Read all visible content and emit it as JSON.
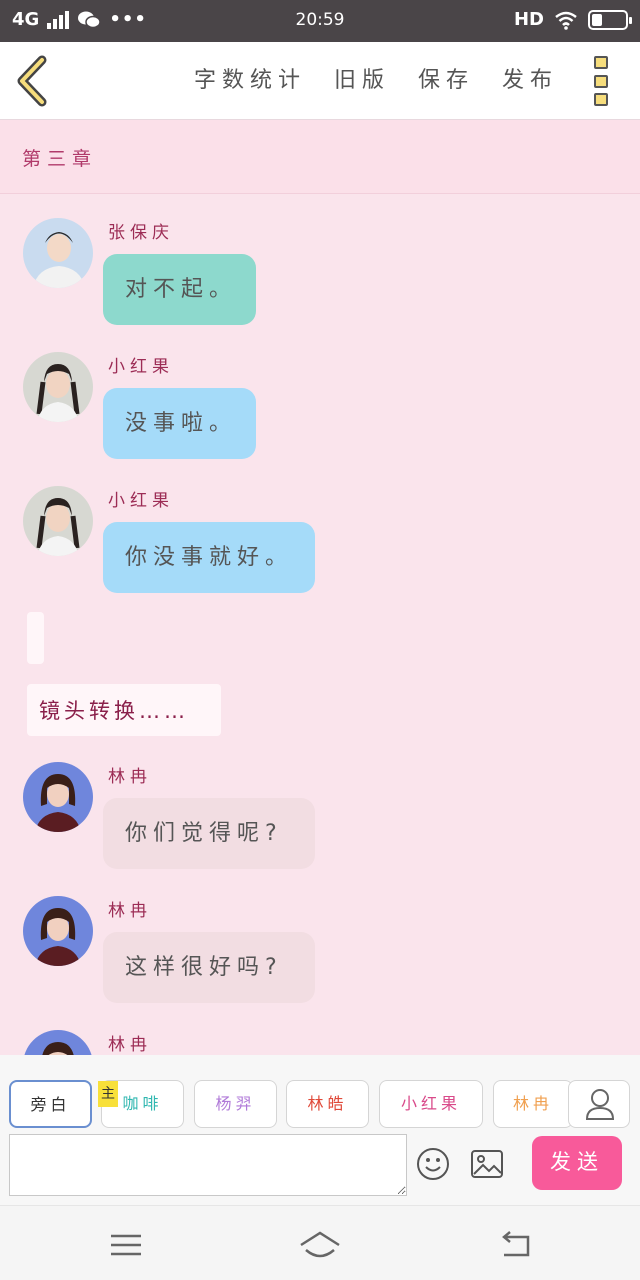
{
  "status_bar": {
    "network": "4G",
    "time": "20:59",
    "hd": "HD"
  },
  "toolbar": {
    "actions": [
      "字数统计",
      "旧版",
      "保存",
      "发布"
    ]
  },
  "chapter": {
    "title": "第三章"
  },
  "messages": [
    {
      "name": "张保庆",
      "text": "对不起。",
      "bubble_color": "#8dd9cd",
      "avatar": "male-portrait"
    },
    {
      "name": "小红果",
      "text": "没事啦。",
      "bubble_color": "#a5dbf9",
      "avatar": "braids-portrait"
    },
    {
      "name": "小红果",
      "text": "你没事就好。",
      "bubble_color": "#a5dbf9",
      "avatar": "braids-portrait"
    },
    {
      "name": "林冉",
      "text": "你们觉得呢?",
      "bubble_color": "#f2dde2",
      "avatar": "short-hair-portrait"
    },
    {
      "name": "林冉",
      "text": "这样很好吗?",
      "bubble_color": "#f2dde2",
      "avatar": "short-hair-portrait"
    },
    {
      "name": "林冉",
      "text": "",
      "bubble_color": "#f2dde2",
      "avatar": "short-hair-portrait"
    }
  ],
  "scene_marker": "镜头转换……",
  "characters": {
    "tag": "主",
    "chips": [
      {
        "label": "旁白",
        "color": "#333333",
        "active": true
      },
      {
        "label": "咖啡",
        "color": "#2fb7b0",
        "active": false
      },
      {
        "label": "杨羿",
        "color": "#b07ad8",
        "active": false
      },
      {
        "label": "林皓",
        "color": "#e04a3a",
        "active": false
      },
      {
        "label": "小红果",
        "color": "#d94a8a",
        "active": false
      },
      {
        "label": "林冉",
        "color": "#f0a050",
        "active": false
      }
    ]
  },
  "composer": {
    "input_value": "",
    "send_label": "发送"
  },
  "icons": {
    "back": "chevron-left-icon",
    "more": "more-icon",
    "emoji": "emoji-icon",
    "image": "image-icon",
    "profile": "user-icon",
    "menu": "menu-icon",
    "home": "home-icon",
    "return": "back-arrow-icon"
  }
}
